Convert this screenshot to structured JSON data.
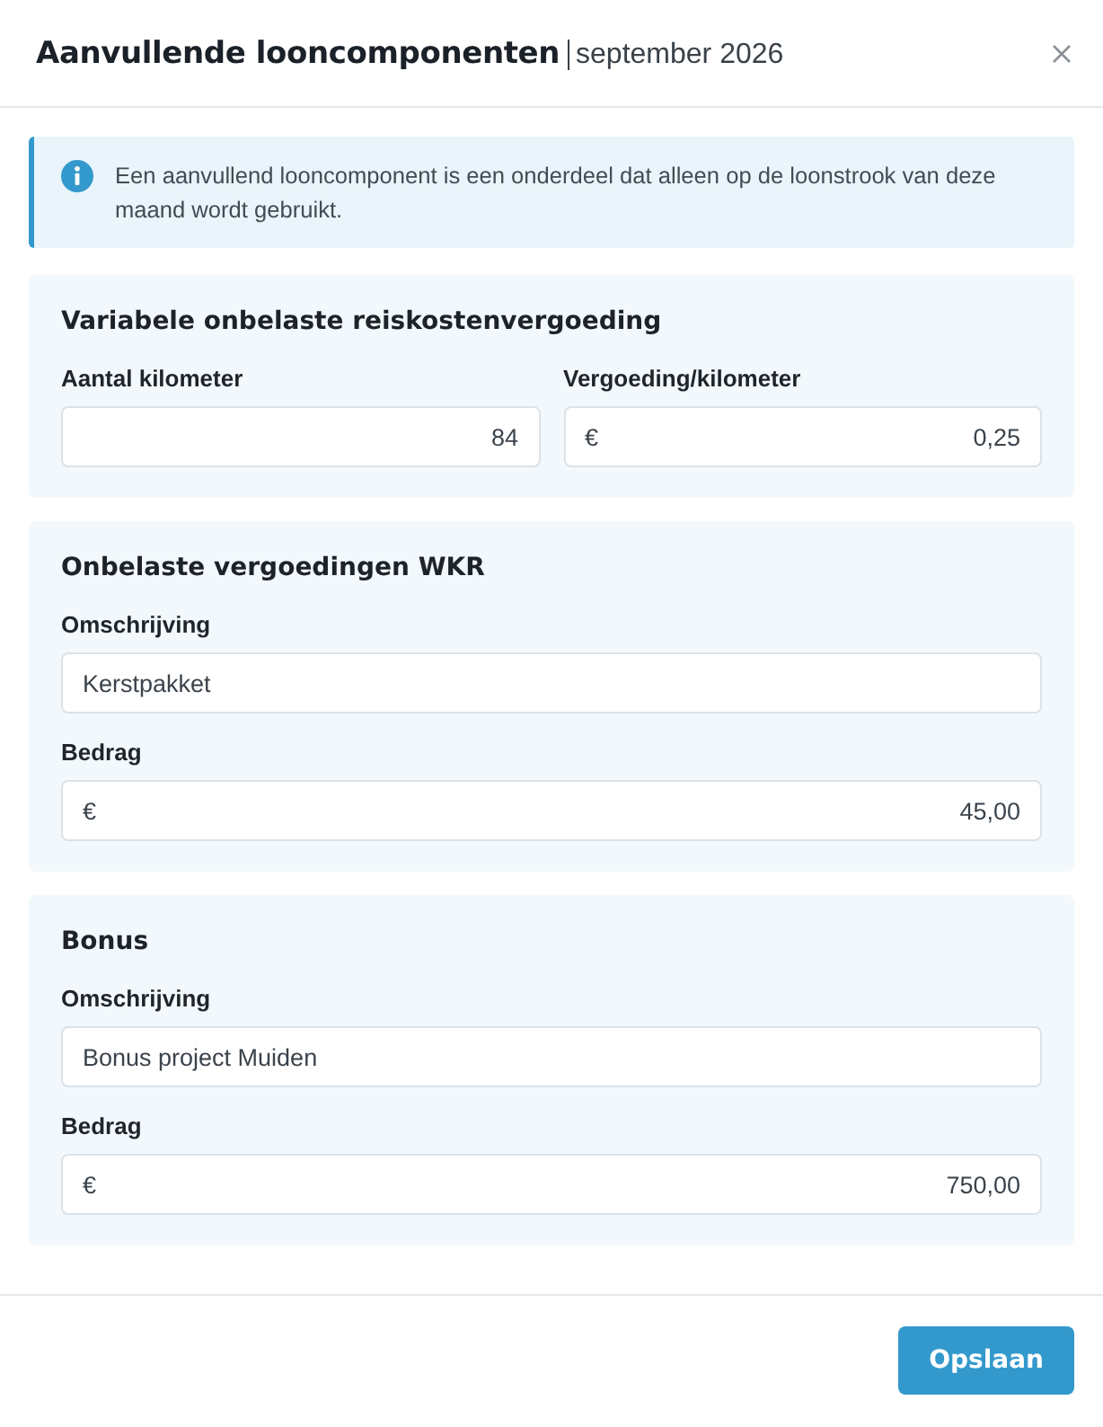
{
  "dialog": {
    "title": "Aanvullende looncomponenten",
    "subtitle": "september 2026"
  },
  "info": {
    "text": "Een aanvullend looncomponent is een onderdeel dat alleen op de loonstrook van deze maand wordt gebruikt."
  },
  "sections": [
    {
      "title": "Variabele onbelaste reiskostenvergoeding",
      "rows": [
        {
          "fields": [
            {
              "label": "Aantal kilometer",
              "kind": "amount",
              "value": "84"
            },
            {
              "label": "Vergoeding/kilometer",
              "kind": "amount",
              "prefix": "€",
              "value": "0,25"
            }
          ]
        }
      ]
    },
    {
      "title": "Onbelaste vergoedingen WKR",
      "rows": [
        {
          "fields": [
            {
              "label": "Omschrijving",
              "kind": "text",
              "value": "Kerstpakket"
            }
          ]
        },
        {
          "fields": [
            {
              "label": "Bedrag",
              "kind": "amount",
              "prefix": "€",
              "value": "45,00"
            }
          ]
        }
      ]
    },
    {
      "title": "Bonus",
      "rows": [
        {
          "fields": [
            {
              "label": "Omschrijving",
              "kind": "text",
              "value": "Bonus project Muiden"
            }
          ]
        },
        {
          "fields": [
            {
              "label": "Bedrag",
              "kind": "amount",
              "prefix": "€",
              "value": "750,00"
            }
          ]
        }
      ]
    }
  ],
  "footer": {
    "buttons": [
      {
        "label": "Opslaan"
      }
    ]
  }
}
